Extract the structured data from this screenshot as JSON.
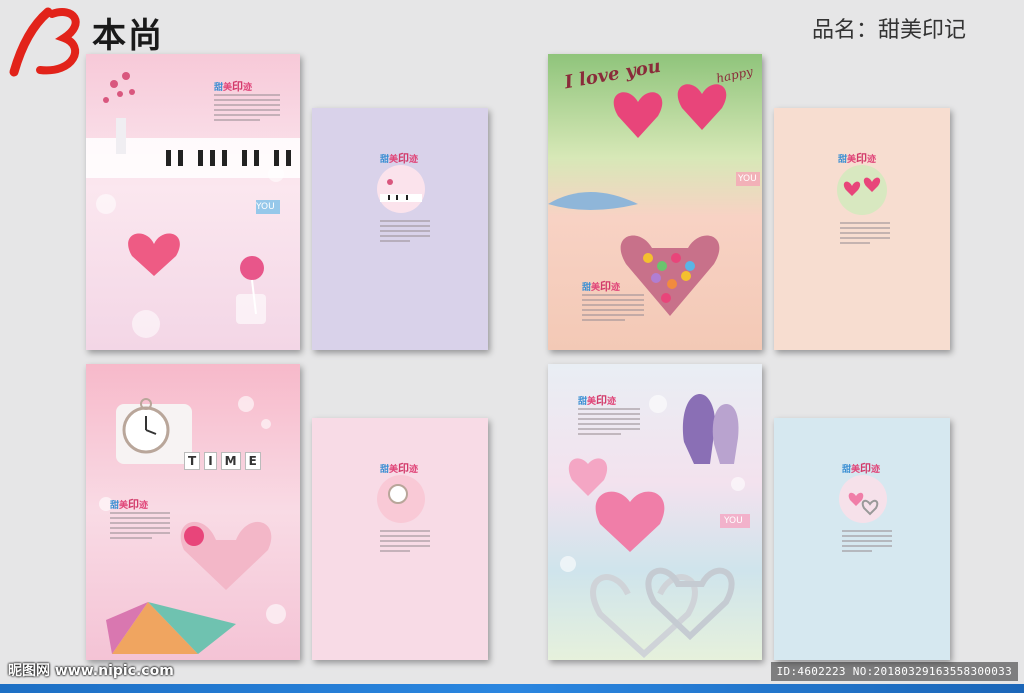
{
  "header": {
    "brand": "本尚",
    "product_name": "品名：甜美印记"
  },
  "covers": {
    "title": "甜美印迹",
    "badge_you": "YOU",
    "time_letters": [
      "T",
      "I",
      "M",
      "E"
    ],
    "love_text": "I love you",
    "happy_text": "happy"
  },
  "watermark": {
    "site": "昵图网 www.nipic.com",
    "id": "ID:4602223 NO:20180329163558300033"
  },
  "colors": {
    "brand_red": "#e2231a",
    "pink": "#f3c6d3",
    "lavender": "#d9d2ea",
    "peach": "#f7ddd0",
    "light_pink": "#f8dbe6",
    "light_blue": "#d6e8f0"
  }
}
